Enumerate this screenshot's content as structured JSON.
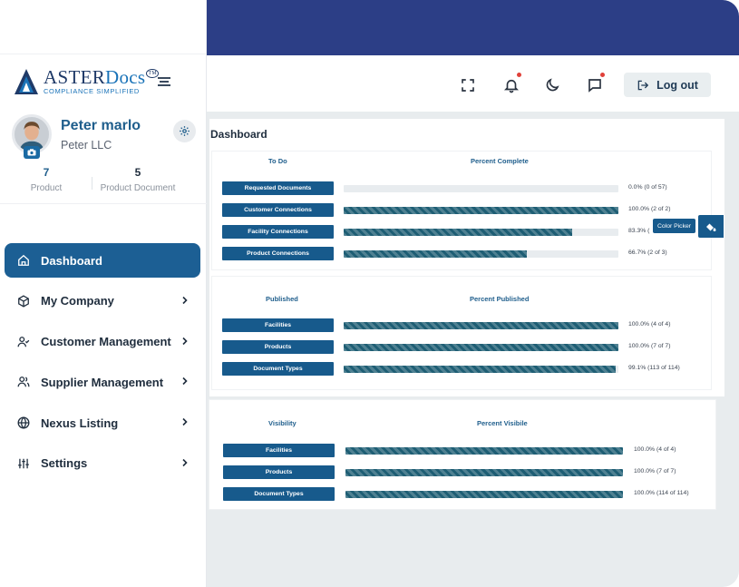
{
  "brand": {
    "name_a": "Aster",
    "name_b": "Docs",
    "tm": "TM",
    "tagline": "COMPLIANCE SIMPLIFIED"
  },
  "profile": {
    "name": "Peter marlo",
    "company": "Peter LLC",
    "stats": [
      {
        "value": "7",
        "label": "Product"
      },
      {
        "value": "5",
        "label": "Product Document"
      }
    ]
  },
  "nav": [
    {
      "label": "Dashboard",
      "icon": "home-icon",
      "active": true
    },
    {
      "label": "My Company",
      "icon": "cube-icon"
    },
    {
      "label": "Customer Management",
      "icon": "user-check-icon"
    },
    {
      "label": "Supplier Management",
      "icon": "users-icon"
    },
    {
      "label": "Nexus Listing",
      "icon": "globe-icon"
    },
    {
      "label": "Settings",
      "icon": "sliders-icon"
    }
  ],
  "toolbar": {
    "logout_label": "Log out"
  },
  "page": {
    "title": "Dashboard"
  },
  "colors": {
    "primary": "#175a8c",
    "topband": "#2c3e86",
    "bar_fill": "#1e5e74",
    "notification_dot": "#e0413a"
  },
  "sections": [
    {
      "col1": "To Do",
      "col2": "Percent Complete",
      "rows": [
        {
          "label": "Requested Documents",
          "percent": 0,
          "text": "0.0% (0 of 57)"
        },
        {
          "label": "Customer Connections",
          "percent": 100,
          "text": "100.0% (2 of 2)"
        },
        {
          "label": "Facility Connections",
          "percent": 83.3,
          "text": "83.3% ("
        },
        {
          "label": "Product Connections",
          "percent": 66.7,
          "text": "66.7% (2 of 3)"
        }
      ]
    },
    {
      "col1": "Published",
      "col2": "Percent Published",
      "rows": [
        {
          "label": "Facilities",
          "percent": 100,
          "text": "100.0% (4 of 4)"
        },
        {
          "label": "Products",
          "percent": 100,
          "text": "100.0% (7 of 7)"
        },
        {
          "label": "Document Types",
          "percent": 99.1,
          "text": "99.1% (113 of 114)"
        }
      ]
    },
    {
      "col1": "Visibility",
      "col2": "Percent Visibile",
      "rows": [
        {
          "label": "Facilities",
          "percent": 100,
          "text": "100.0% (4 of 4)"
        },
        {
          "label": "Products",
          "percent": 100,
          "text": "100.0% (7 of 7)"
        },
        {
          "label": "Document Types",
          "percent": 100,
          "text": "100.0% (114 of 114)"
        }
      ]
    }
  ],
  "color_picker": {
    "label": "Color Picker"
  }
}
